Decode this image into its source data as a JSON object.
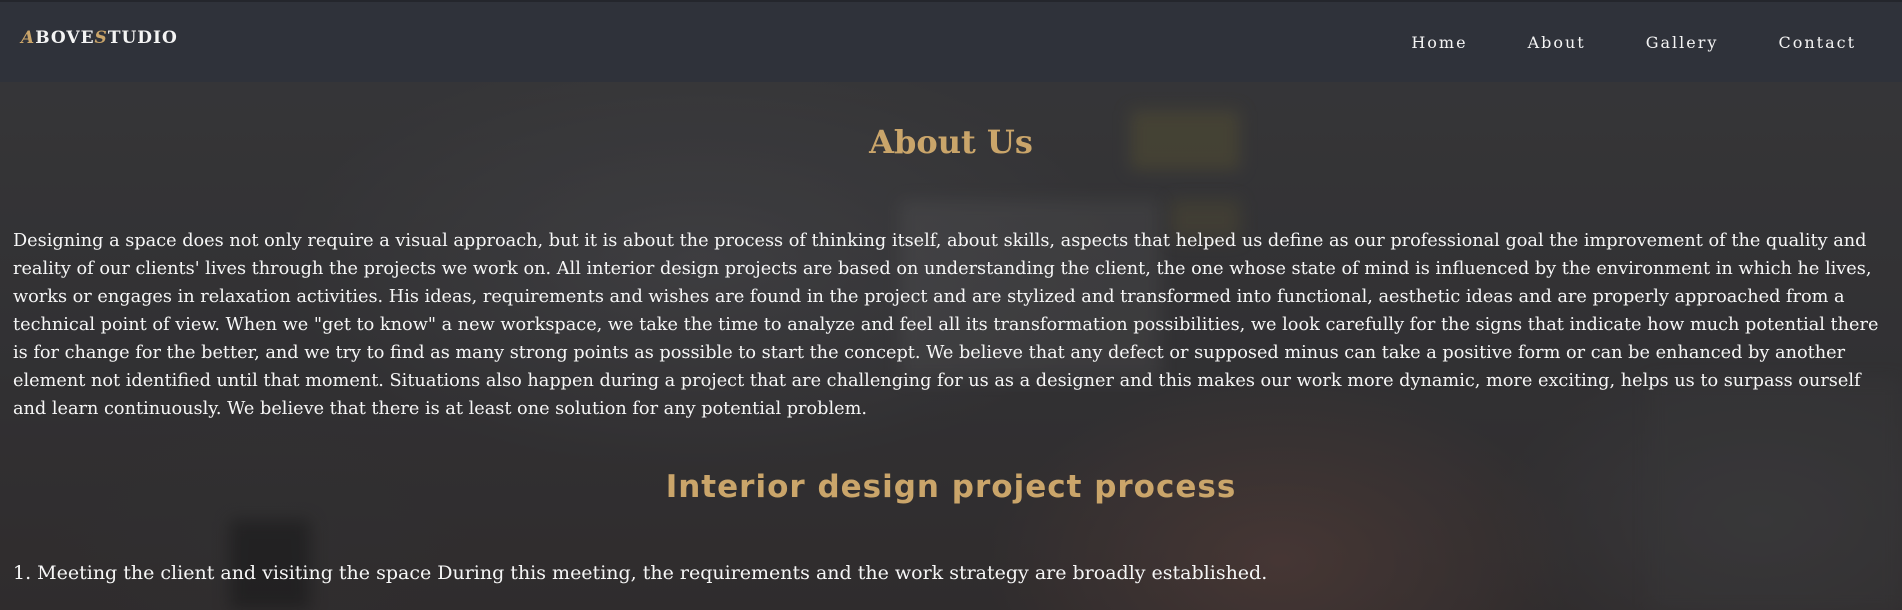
{
  "brand": {
    "parts": [
      "A",
      "BOVE",
      "S",
      "TUDIO"
    ]
  },
  "nav": {
    "items": [
      "Home",
      "About",
      "Gallery",
      "Contact"
    ]
  },
  "main": {
    "title": "About Us",
    "paragraph": "Designing a space does not only require a visual approach, but it is about the process of thinking itself, about skills, aspects that helped us define as our professional goal the improvement of the quality and reality of our clients' lives through the projects we work on. All interior design projects are based on understanding the client, the one whose state of mind is influenced by the environment in which he lives, works or engages in relaxation activities. His ideas, requirements and wishes are found in the project and are stylized and transformed into functional, aesthetic ideas and are properly approached from a technical point of view. When we \"get to know\" a new workspace, we take the time to analyze and feel all its transformation possibilities, we look carefully for the signs that indicate how much potential there is for change for the better, and we try to find as many strong points as possible to start the concept. We believe that any defect or supposed minus can take a positive form or can be enhanced by another element not identified until that moment. Situations also happen during a project that are challenging for us as a designer and this makes our work more dynamic, more exciting, helps us to surpass ourself and learn continuously. We believe that there is at least one solution for any potential problem.",
    "subtitle": "Interior design project process",
    "steps": [
      "1. Meeting the client and visiting the space During this meeting, the requirements and the work strategy are broadly established."
    ]
  },
  "colors": {
    "accent": "#caa56a",
    "navbar": "#2f323a",
    "text": "#f6f6f6"
  }
}
